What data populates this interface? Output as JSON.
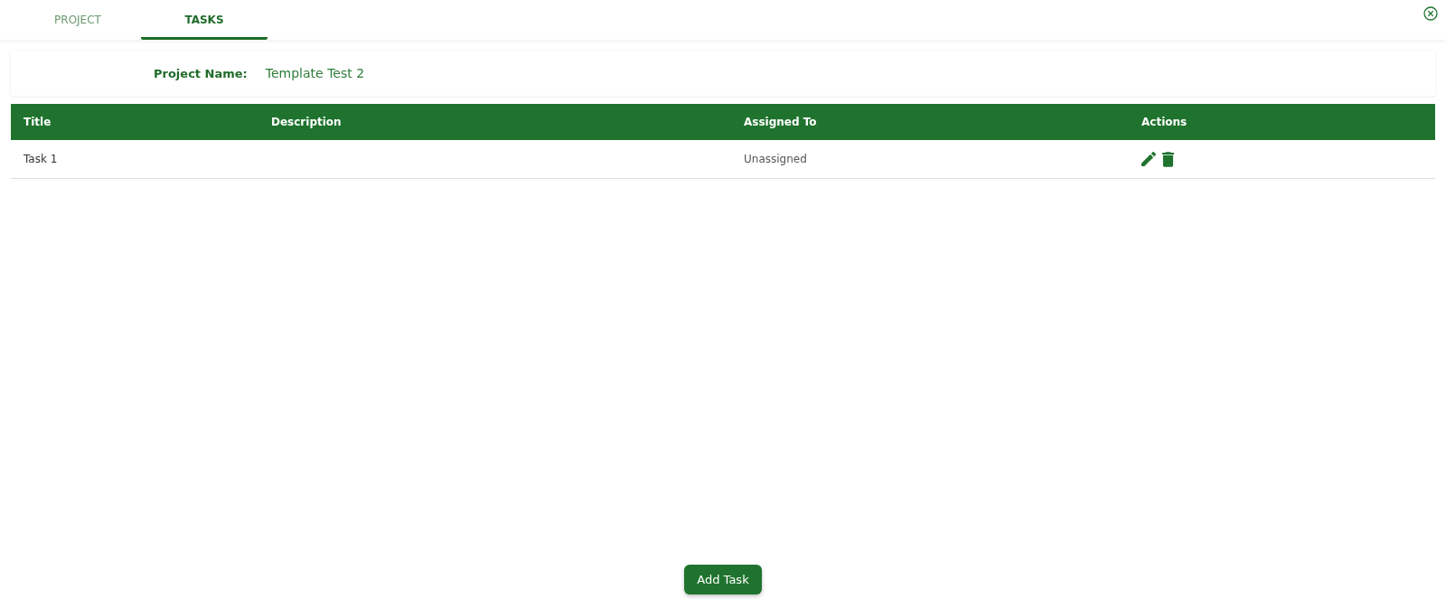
{
  "tabs": [
    {
      "label": "PROJECT",
      "selected": false
    },
    {
      "label": "TASKS",
      "selected": true
    }
  ],
  "project": {
    "label": "Project Name:",
    "value": "Template Test 2"
  },
  "table": {
    "columns": [
      "Title",
      "Description",
      "Assigned To",
      "Actions"
    ],
    "rows": [
      {
        "title": "Task 1",
        "description": "",
        "assigned_to": "Unassigned"
      }
    ]
  },
  "add_button": "Add Task"
}
